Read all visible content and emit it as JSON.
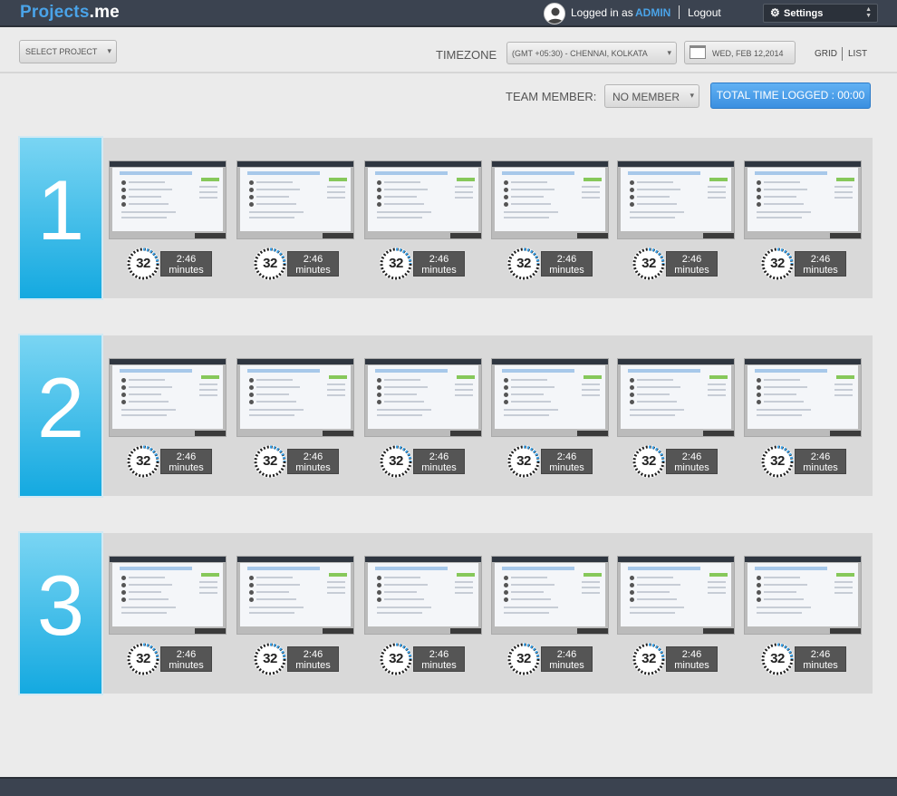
{
  "header": {
    "logo_part1": "Projects",
    "logo_part2": ".me",
    "logged_in_as": "Logged in as",
    "username": "ADMIN",
    "logout": "Logout",
    "settings": "Settings"
  },
  "filters": {
    "select_project": "SELECT PROJECT",
    "timezone_label": "TIMEZONE",
    "timezone_value": "(GMT +05:30) - CHENNAI, KOLKATA",
    "date": "WED, FEB 12,2014",
    "view_grid": "GRID",
    "view_list": "LIST"
  },
  "team": {
    "label": "TEAM MEMBER:",
    "value": "NO MEMBER",
    "total_time": "TOTAL TIME LOGGED : 00:00"
  },
  "rows": [
    {
      "number": "1",
      "items": [
        {
          "count": "32",
          "time": "2:46",
          "unit": "minutes"
        },
        {
          "count": "32",
          "time": "2:46",
          "unit": "minutes"
        },
        {
          "count": "32",
          "time": "2:46",
          "unit": "minutes"
        },
        {
          "count": "32",
          "time": "2:46",
          "unit": "minutes"
        },
        {
          "count": "32",
          "time": "2:46",
          "unit": "minutes"
        },
        {
          "count": "32",
          "time": "2:46",
          "unit": "minutes"
        }
      ]
    },
    {
      "number": "2",
      "items": [
        {
          "count": "32",
          "time": "2:46",
          "unit": "minutes"
        },
        {
          "count": "32",
          "time": "2:46",
          "unit": "minutes"
        },
        {
          "count": "32",
          "time": "2:46",
          "unit": "minutes"
        },
        {
          "count": "32",
          "time": "2:46",
          "unit": "minutes"
        },
        {
          "count": "32",
          "time": "2:46",
          "unit": "minutes"
        },
        {
          "count": "32",
          "time": "2:46",
          "unit": "minutes"
        }
      ]
    },
    {
      "number": "3",
      "items": [
        {
          "count": "32",
          "time": "2:46",
          "unit": "minutes"
        },
        {
          "count": "32",
          "time": "2:46",
          "unit": "minutes"
        },
        {
          "count": "32",
          "time": "2:46",
          "unit": "minutes"
        },
        {
          "count": "32",
          "time": "2:46",
          "unit": "minutes"
        },
        {
          "count": "32",
          "time": "2:46",
          "unit": "minutes"
        },
        {
          "count": "32",
          "time": "2:46",
          "unit": "minutes"
        }
      ]
    }
  ],
  "colors": {
    "header_bg": "#3b4350",
    "accent_blue": "#4aa3e8",
    "row_tile_top": "#7ad5f3",
    "row_tile_bottom": "#14a9e0",
    "button_blue": "#3b8fe0"
  }
}
